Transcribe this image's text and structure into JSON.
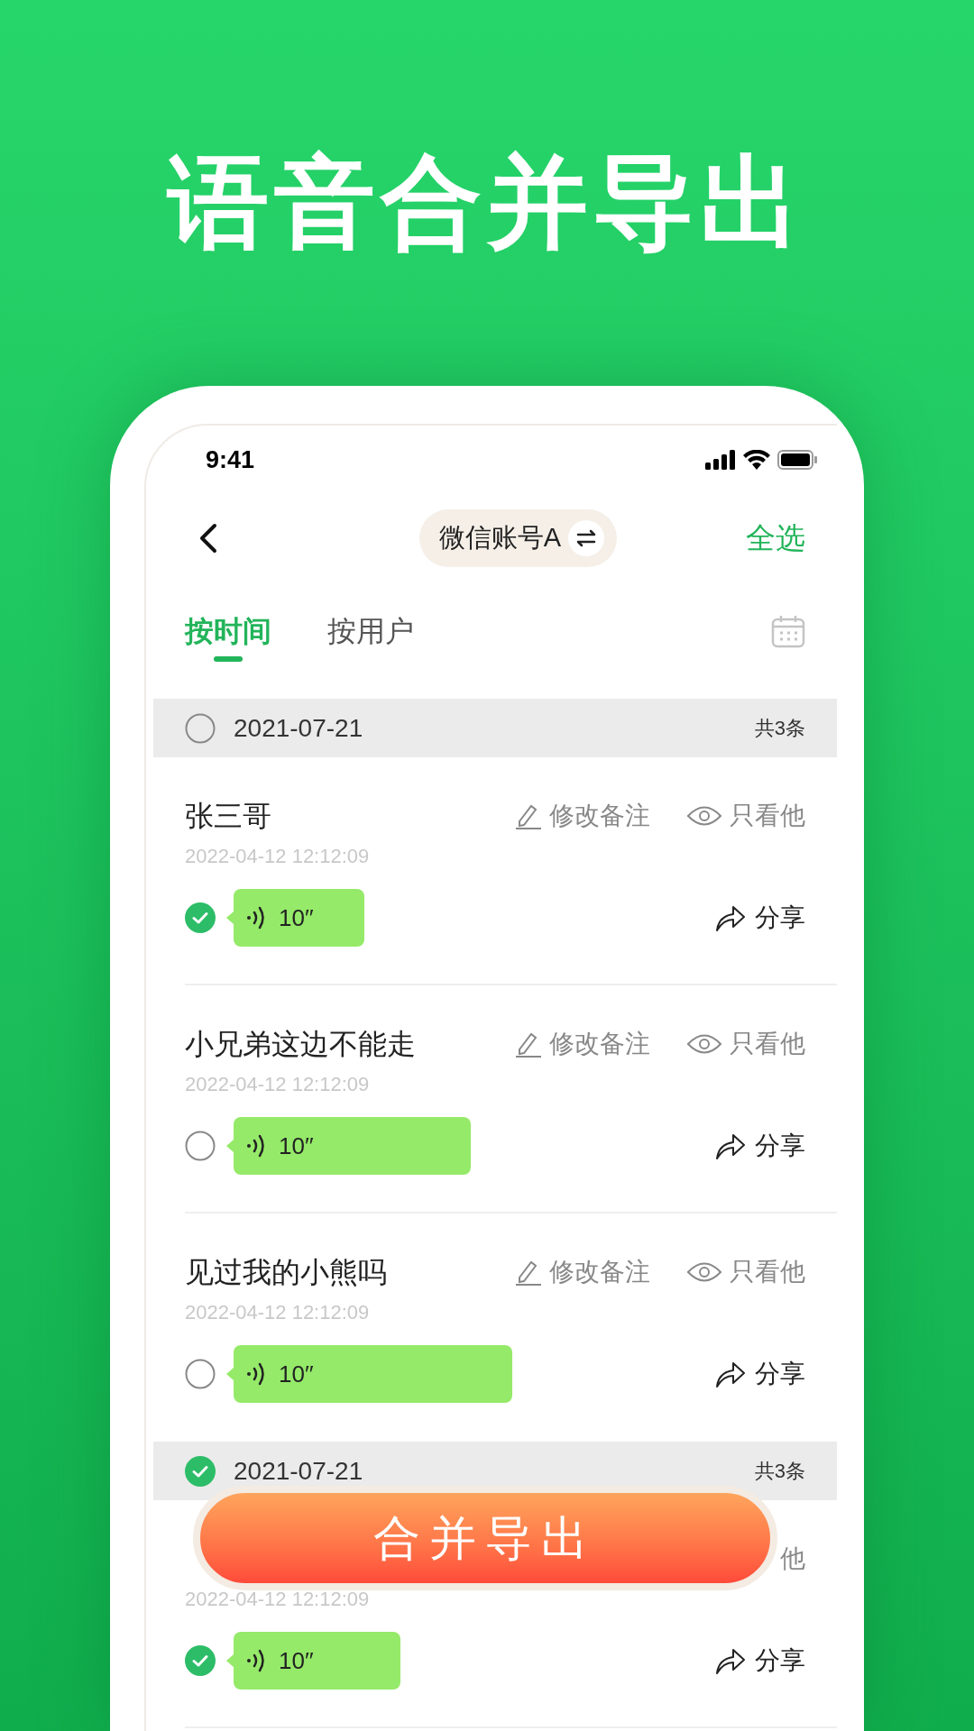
{
  "headline": "语音合并导出",
  "status_bar": {
    "time": "9:41"
  },
  "nav": {
    "account": "微信账号A",
    "select_all": "全选"
  },
  "tabs": [
    {
      "label": "按时间",
      "selected": true
    },
    {
      "label": "按用户",
      "selected": false
    }
  ],
  "groups": [
    {
      "date": "2021-07-21",
      "count": "共3条",
      "checked": false,
      "items": [
        {
          "name": "张三哥",
          "edit_label": "修改备注",
          "view_label": "只看他",
          "time": "2022-04-12 12:12:09",
          "duration": "10′′",
          "checked": true,
          "share": "分享"
        },
        {
          "name": "小兄弟这边不能走",
          "edit_label": "修改备注",
          "view_label": "只看他",
          "time": "2022-04-12 12:12:09",
          "duration": "10′′",
          "checked": false,
          "share": "分享"
        },
        {
          "name": "见过我的小熊吗",
          "edit_label": "修改备注",
          "view_label": "只看他",
          "time": "2022-04-12 12:12:09",
          "duration": "10′′",
          "checked": false,
          "share": "分享"
        }
      ]
    },
    {
      "date": "2021-07-21",
      "count": "共3条",
      "checked": true,
      "items": [
        {
          "view_label": "他",
          "time": "2022-04-12 12:12:09",
          "duration": "10′′",
          "checked": true,
          "share": "分享"
        }
      ]
    }
  ],
  "export_button": "合并导出"
}
